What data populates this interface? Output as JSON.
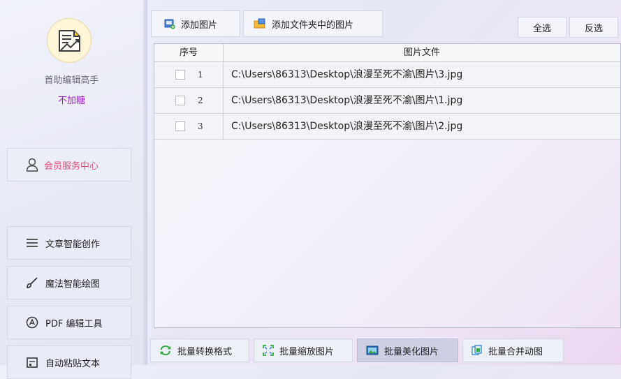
{
  "sidebar": {
    "user_name": "首助编辑高手",
    "user_status": "不加糖",
    "member_center": "会员服务中心",
    "nav_items": [
      {
        "label": "文章智能创作",
        "icon": "menu-lines-icon"
      },
      {
        "label": "魔法智能绘图",
        "icon": "brush-icon"
      },
      {
        "label": "PDF 编辑工具",
        "icon": "pdf-icon"
      },
      {
        "label": "自动粘贴文本",
        "icon": "paste-icon"
      }
    ]
  },
  "toolbar": {
    "add_image": "添加图片",
    "add_folder_images": "添加文件夹中的图片",
    "select_all": "全选",
    "invert_selection": "反选"
  },
  "table": {
    "headers": [
      "序号",
      "图片文件"
    ],
    "rows": [
      {
        "no": "1",
        "path": "C:\\Users\\86313\\Desktop\\浪漫至死不渝\\图片\\3.jpg",
        "checked": false
      },
      {
        "no": "2",
        "path": "C:\\Users\\86313\\Desktop\\浪漫至死不渝\\图片\\1.jpg",
        "checked": false
      },
      {
        "no": "3",
        "path": "C:\\Users\\86313\\Desktop\\浪漫至死不渝\\图片\\2.jpg",
        "checked": false
      }
    ]
  },
  "bottom_tabs": [
    {
      "label": "批量转换格式",
      "active": false
    },
    {
      "label": "批量缩放图片",
      "active": false
    },
    {
      "label": "批量美化图片",
      "active": true
    },
    {
      "label": "批量合并动图",
      "active": false
    }
  ],
  "colors": {
    "status_purple": "#a020c8",
    "member_pink": "#e2507a"
  }
}
